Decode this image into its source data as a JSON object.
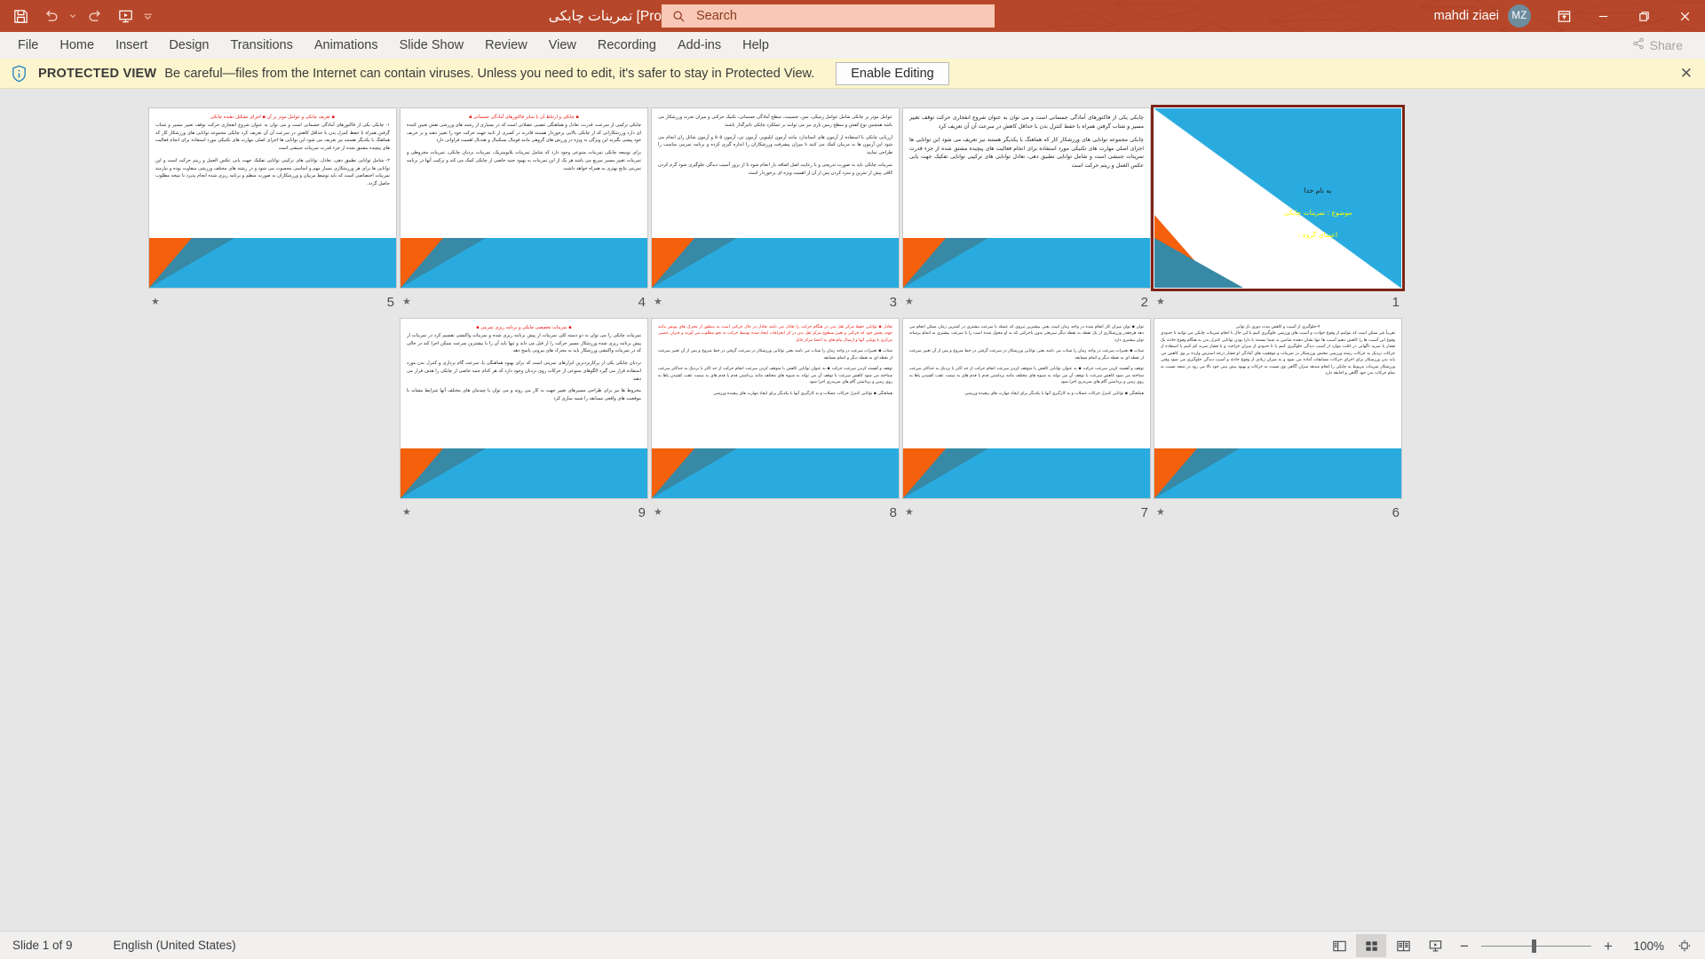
{
  "titlebar": {
    "document_title": "تمرینات چابکی [Protected View]  -  PowerPoint",
    "quick_access": [
      {
        "name": "save",
        "icon": "save-icon"
      },
      {
        "name": "undo",
        "icon": "undo-icon"
      },
      {
        "name": "redo",
        "icon": "redo-icon"
      },
      {
        "name": "start-presentation",
        "icon": "present-icon"
      },
      {
        "name": "customize-qat",
        "icon": "chevron-down-icon"
      }
    ],
    "account_name": "mahdi ziaei",
    "account_initials": "MZ",
    "window_buttons": [
      "ribbon-display-options",
      "minimize",
      "restore",
      "close"
    ],
    "background_color": "#b7472a"
  },
  "search": {
    "placeholder": "Search",
    "value": "",
    "icon": "search-icon"
  },
  "ribbon": {
    "tabs": [
      {
        "label": "File"
      },
      {
        "label": "Home"
      },
      {
        "label": "Insert"
      },
      {
        "label": "Design"
      },
      {
        "label": "Transitions"
      },
      {
        "label": "Animations"
      },
      {
        "label": "Slide Show"
      },
      {
        "label": "Review"
      },
      {
        "label": "View"
      },
      {
        "label": "Recording"
      },
      {
        "label": "Add-ins"
      },
      {
        "label": "Help"
      }
    ],
    "share_label": "Share"
  },
  "protected_view": {
    "icon": "shield-info-icon",
    "label": "PROTECTED VIEW",
    "message": "Be careful—files from the Internet can contain viruses. Unless you need to edit, it's safer to stay in Protected View.",
    "enable_editing_label": "Enable Editing",
    "close_label": "✕",
    "background_color": "#fcf5cd"
  },
  "theme": {
    "accent_cyan": "#29abdf",
    "accent_orange": "#f4600c",
    "accent_teal": "#3789a6",
    "selection_border": "#7d2318",
    "title_highlight": "#ffff00",
    "red_text": "#e8130d"
  },
  "slides": [
    {
      "number": "5",
      "animation_marker": "★",
      "selected": false,
      "layout": "content",
      "heading": "▪ تعریف چابکی و عوامل موثر بر آن ▪ اجزای تشکیل دهنده چابکی",
      "paragraphs": [
        "۱- چابکی یکی از فاکتورهای آمادگی جسمانی است و می توان به عنوان شروع انفجاری حرکت توقف تغییر مسیر و شتاب گرفتن همراه با حفظ کنترل بدن با حداقل کاهش در سرعت آن آن تعریف کرد چابکی مجموعه توانایی های ورزشکار کار که هماهنگ با یکدیگر هستند نیز تعریف می شود این توانایی ها اجزای اصلی مهارت های تکنیکی مورد استفاده برای انجام فعالیت های پیچیده مشتق شده از جزء قدرت تمرینات جنبشی است",
        "۲- شامل توانایی تطبیق دهی، تعادل، توانایی های ترکیبی توانایی تفکیک جهت یابی عکس العمل و ریتم حرکت است و این توانایی ها برای هر ورزشکاری بسیار مهم و اساسی محسوب می شود و در رشته های مختلف ورزشی متفاوت بوده و نیازمند تمرینات اختصاصی است که باید توسط مربیان و ورزشکاران به صورت منظم و برنامه ریزی شده انجام پذیرد تا نتیجه مطلوب حاصل گردد."
      ]
    },
    {
      "number": "4",
      "animation_marker": "★",
      "selected": false,
      "layout": "content",
      "heading": "▪ چابکی و ارتباط آن با سایر فاکتورهای آمادگی جسمانی ▪",
      "paragraphs": [
        "چابکی ترکیبی از سرعت، قدرت، تعادل و هماهنگی عصبی عضلانی است که در بسیاری از رشته های ورزشی نقش تعیین کننده ای دارد ورزشکارانی که از چابکی بالایی برخوردار هستند قادرند در کسری از ثانیه جهت حرکت خود را تغییر دهند و بر حریف خود پیشی بگیرند این ویژگی به ویژه در ورزش های گروهی مانند فوتبال بسکتبال و هندبال اهمیت فراوانی دارد",
        "برای توسعه چابکی تمرینات متنوعی وجود دارد که شامل تمرینات پلایومتریک، تمرینات نردبان چابکی، تمرینات مخروطی و تمرینات تغییر مسیر سریع می باشد هر یک از این تمرینات به بهبود جنبه خاصی از چابکی کمک می کند و ترکیب آنها در برنامه تمرینی نتایج بهتری به همراه خواهد داشت"
      ]
    },
    {
      "number": "3",
      "animation_marker": "★",
      "selected": false,
      "layout": "content",
      "heading": "",
      "paragraphs": [
        "عوامل موثر بر چابکی شامل عوامل ژنتیکی، سن، جنسیت، سطح آمادگی جسمانی، تکنیک حرکتی و میزان تجربه ورزشکار می باشد همچنین نوع کفش و سطح زمین بازی نیز می توانند بر عملکرد چابکی تاثیرگذار باشند",
        "ارزیابی چابکی با استفاده از آزمون های استاندارد مانند آزمون ایلینویز، آزمون تی، آزمون ۵۰۵ و آزمون شاتل ران انجام می شود این آزمون ها به مربیان کمک می کنند تا میزان پیشرفت ورزشکاران را اندازه گیری کرده و برنامه تمرینی مناسب را طراحی نمایند",
        "تمرینات چابکی باید به صورت تدریجی و با رعایت اصل اضافه بار انجام شود تا از بروز آسیب دیدگی جلوگیری شود گرم کردن کافی پیش از تمرین و سرد کردن پس از آن از اهمیت ویژه ای برخوردار است"
      ]
    },
    {
      "number": "2",
      "animation_marker": "★",
      "selected": false,
      "layout": "content-large",
      "heading": "",
      "paragraphs": [
        "چابکی یکی از فاکتورهای آمادگی جسمانی است و می توان به عنوان شروع انفجاری حرکت توقف تغییر مسیر و شتاب گرفتن همراه با حفظ کنترل بدن با حداقل کاهش در سرعت آن آن تعریف کرد",
        "چابکی مجموعه توانایی های ورزشکار کار که هماهنگ با یکدیگر هستند نیز تعریف می شود این توانایی ها اجزای اصلی مهارت های تکنیکی مورد استفاده برای انجام فعالیت های پیچیده مشتق شده از جزء قدرت تمرینات جنبشی است و شامل توانایی تطبیق دهی، تعادل توانایی های ترکیبی توانایی تفکیک جهت یابی عکس العمل و ریتم حرکت است"
      ]
    },
    {
      "number": "1",
      "animation_marker": "★",
      "selected": true,
      "layout": "title",
      "title_lines": [
        {
          "text": "به نام خدا",
          "highlight": false
        },
        {
          "text": "موضوع : تمرینات چابکی",
          "highlight": true
        },
        {
          "text": "اعضای گروه :",
          "highlight": true
        }
      ]
    },
    {
      "number": "9",
      "animation_marker": "★",
      "selected": false,
      "layout": "content",
      "heading": "▪ تمرینات تخصصی چابکی و برنامه ریزی تمرینی ▪",
      "paragraphs": [
        "تمرینات چابکی را می توان به دو دسته کلی تمرینات از پیش برنامه ریزی شده و تمرینات واکنشی تقسیم کرد در تمرینات از پیش برنامه ریزی شده ورزشکار مسیر حرکت را از قبل می داند و تنها باید آن را با بیشترین سرعت ممکن اجرا کند در حالی که در تمرینات واکنشی ورزشکار باید به محرک های بیرونی پاسخ دهد",
        "نردبان چابکی یکی از پرکاربردترین ابزارهای تمرینی است که برای بهبود هماهنگی پا، سرعت گام برداری و کنترل بدن مورد استفاده قرار می گیرد الگوهای متنوعی از حرکات روی نردبان وجود دارد که هر کدام جنبه خاصی از چابکی را هدف قرار می دهند",
        "مخروط ها نیز برای طراحی مسیرهای تغییر جهت به کار می روند و می توان با چیدمان های مختلف آنها شرایط مشابه با موقعیت های واقعی مسابقه را شبیه سازی کرد"
      ]
    },
    {
      "number": "8",
      "animation_marker": "★",
      "selected": false,
      "layout": "content",
      "heading": "",
      "red_lead": "تعادل",
      "paragraphs": [
        "تعادل ▪ توانایی حفظ مرکز ثقل بدن در هنگام حرکت را تعادل می نامند تعادل در حال حرکتی است به منظور از محرک های پویش مانند جهت پخش خود که حرکتی و تغییر سطوح مرکز ثقل بدن در اثر انحرافات ایجاد شده توسط حرکت به نحو مطلوب می آورند و جبران عصبی مرکزی با پویایی آنها و ارسال پیام های به اعضا مرکز قابل",
        "شتاب ▪ تغییرات سرعت در واحد زمان را شتاب می نامند یعنی توانایی ورزشکار در سرعت گرفتن در خط شروع و پس از آن تغییر سرعت از نقطه ای به نقطه دیگر و اتمام مسابقه",
        "توقف و آهسته کردن سرعت حرکت ▪ به عنوان توانایی کاهش یا متوقف کردن سرعت انجام حرکت از حد اکثر یا نزدیک به حداکثر سرعت شناخته می شود کاهش سرعت یا توقف آن می تواند به شیوه های مختلف مانند برداشتن قدم یا قدم های به سمت عقب کشیدن پاها به روی زمین و برداشتن گام های ضربدری اجرا شود",
        "هماهنگی ▪ توانایی کنترل حرکات عضلات و به کارگیری آنها با یکدیگر برای ایجاد مهارت های پیچیده ورزشی"
      ]
    },
    {
      "number": "7",
      "animation_marker": "★",
      "selected": false,
      "layout": "content-red",
      "heading": "",
      "paragraphs": [
        "توان ▪ توان میزان کار انجام شده در واحد زمان است یعنی بیشترین نیروی که عضله با سرعت بیشتری در کمترین زمان ممکن انجام می دهد هرچقدر ورزشکاری از یک نقطه به نقطه دیگر سریعتر بدون یاحرکتی که به او محول شده است را با سرعت بیشتری به اتمام برساند توان بیشتری دارد",
        "شتاب ▪ تغییرات سرعت در واحد زمان را شتاب می نامند یعنی توانایی ورزشکار در سرعت گرفتن در خط شروع و پس از آن تغییر سرعت از نقطه ای به نقطه دیگر و اتمام مسابقه",
        "توقف و آهسته کردن سرعت حرکت ▪ به عنوان توانایی کاهش یا متوقف کردن سرعت انجام حرکت از حد اکثر یا نزدیک به حداکثر سرعت شناخته می شود کاهش سرعت یا توقف آن می تواند به شیوه های مختلف مانند برداشتن قدم یا قدم های به سمت عقب کشیدن پاها به روی زمین و برداشتن گام های ضربدری اجرا شود",
        "هماهنگی ▪ توانایی کنترل حرکات عضلات و به کارگیری آنها با یکدیگر برای ایجاد مهارت های پیچیده ورزشی"
      ]
    },
    {
      "number": "6",
      "animation_marker": "★",
      "selected": false,
      "layout": "content-large",
      "heading": "۴-جلوگیری از آسیب و کاهش مدت دوری باز توانی",
      "paragraphs": [
        "تقریباً غیر ممکن است که بتوانیم از وقوع حوادث و آسیب های ورزشی جلوگیری کنیم با این حال با انجام تمرینات چابکی می توانید تا حدودی وقوع این آسیب ها را کاهش دهیم آسیب ها تنها نشان دهنده شانس بد شما نیستند با دارا بودن توانایی کنترل بدن به هنگام وقوع حادثه یک فشار یا ضربه ناگهانی در اغلب موارد از آسیب دیدگی جلوگیری کنیم یا تا حدودی از میزان جراحت و یا فشار ضربه کم کنیم با استفاده از حرکات نزدیک به حرکات رشته ورزشی مختص ورزشکار در تمرینات و موقعیت های آمادگی او فشار درجه استرس وارده بر وی کاهش می یابد بدن ورزشکار برای اجرای حرکات مسابقات آماده می شود و به میزان زیادی از وقوع حادثه و آسیب دیدگی جلوگیری می شود وقتی ورزشکار تمرینات مربوط به چابکی را انجام میدهد میزان آگاهی وی نسبت به حرکات و بهبود پیش بینی خود بالا می رود در نتیجه نسبت به تمام حرکات بدن خود آگاهی و احاطه دارد"
      ]
    }
  ],
  "statusbar": {
    "slide_counter": "Slide 1 of 9",
    "language": "English (United States)",
    "view_buttons": [
      {
        "name": "normal-view",
        "icon": "normal-view-icon",
        "active": false
      },
      {
        "name": "slide-sorter-view",
        "icon": "slide-sorter-icon",
        "active": true
      },
      {
        "name": "reading-view",
        "icon": "reading-view-icon",
        "active": false
      },
      {
        "name": "slide-show-view",
        "icon": "slide-show-icon",
        "active": false
      }
    ],
    "zoom_out_label": "−",
    "zoom_in_label": "+",
    "zoom_level": "100%",
    "fit_label": "fit-to-window"
  }
}
